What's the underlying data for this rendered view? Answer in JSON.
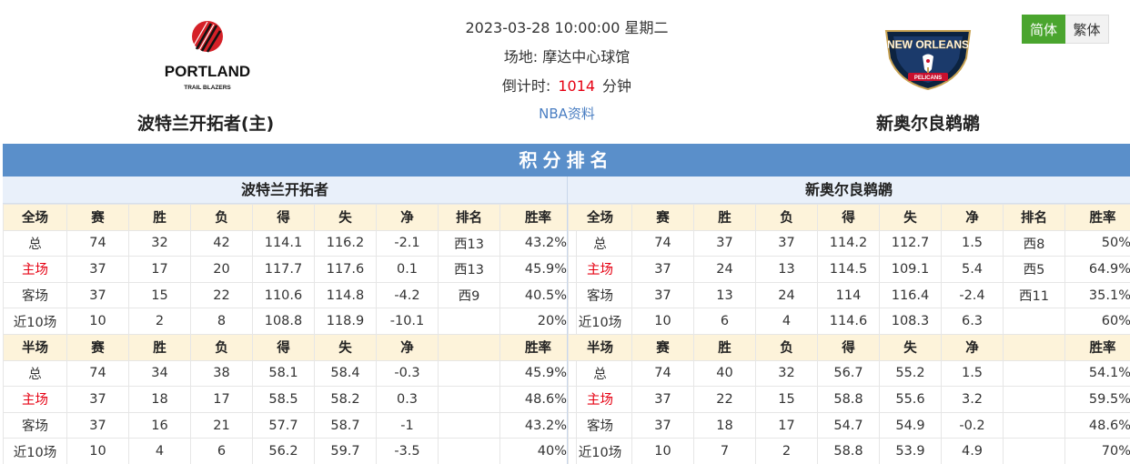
{
  "header": {
    "datetime": "2023-03-28 10:00:00 星期二",
    "venue": "场地: 摩达中心球馆",
    "countdown_label": "倒计时:",
    "countdown_value": "1014",
    "countdown_unit": "分钟",
    "nba_link": "NBA资料",
    "lang": {
      "simplified": "简体",
      "traditional": "繁体"
    },
    "home_team": {
      "name": "波特兰开拓者(主)",
      "logo_text": "PORTLAND",
      "logo_sub": "TRAIL BLAZERS",
      "logo_icon": "trail-blazers-pinwheel"
    },
    "away_team": {
      "name": "新奥尔良鹈鹕",
      "logo_text": "NEW ORLEANS",
      "logo_sub": "PELICANS",
      "logo_icon": "pelicans-shield"
    }
  },
  "colors": {
    "title_bar": "#5a8fca",
    "header_row": "#fdf3da",
    "home_highlight": "#e60012",
    "active_lang": "#4aa52e"
  },
  "standings": {
    "title": "积分排名",
    "home": {
      "team": "波特兰开拓者",
      "full": {
        "header": [
          "全场",
          "赛",
          "胜",
          "负",
          "得",
          "失",
          "净",
          "排名",
          "胜率"
        ],
        "rows": [
          [
            "总",
            "74",
            "32",
            "42",
            "114.1",
            "116.2",
            "-2.1",
            "西13",
            "43.2%"
          ],
          [
            "主场",
            "37",
            "17",
            "20",
            "117.7",
            "117.6",
            "0.1",
            "西13",
            "45.9%"
          ],
          [
            "客场",
            "37",
            "15",
            "22",
            "110.6",
            "114.8",
            "-4.2",
            "西9",
            "40.5%"
          ],
          [
            "近10场",
            "10",
            "2",
            "8",
            "108.8",
            "118.9",
            "-10.1",
            "",
            "20%"
          ]
        ]
      },
      "half": {
        "header": [
          "半场",
          "赛",
          "胜",
          "负",
          "得",
          "失",
          "净",
          "",
          "胜率"
        ],
        "rows": [
          [
            "总",
            "74",
            "34",
            "38",
            "58.1",
            "58.4",
            "-0.3",
            "",
            "45.9%"
          ],
          [
            "主场",
            "37",
            "18",
            "17",
            "58.5",
            "58.2",
            "0.3",
            "",
            "48.6%"
          ],
          [
            "客场",
            "37",
            "16",
            "21",
            "57.7",
            "58.7",
            "-1",
            "",
            "43.2%"
          ],
          [
            "近10场",
            "10",
            "4",
            "6",
            "56.2",
            "59.7",
            "-3.5",
            "",
            "40%"
          ]
        ]
      }
    },
    "away": {
      "team": "新奥尔良鹈鹕",
      "full": {
        "header": [
          "全场",
          "赛",
          "胜",
          "负",
          "得",
          "失",
          "净",
          "排名",
          "胜率"
        ],
        "rows": [
          [
            "总",
            "74",
            "37",
            "37",
            "114.2",
            "112.7",
            "1.5",
            "西8",
            "50%"
          ],
          [
            "主场",
            "37",
            "24",
            "13",
            "114.5",
            "109.1",
            "5.4",
            "西5",
            "64.9%"
          ],
          [
            "客场",
            "37",
            "13",
            "24",
            "114",
            "116.4",
            "-2.4",
            "西11",
            "35.1%"
          ],
          [
            "近10场",
            "10",
            "6",
            "4",
            "114.6",
            "108.3",
            "6.3",
            "",
            "60%"
          ]
        ]
      },
      "half": {
        "header": [
          "半场",
          "赛",
          "胜",
          "负",
          "得",
          "失",
          "净",
          "",
          "胜率"
        ],
        "rows": [
          [
            "总",
            "74",
            "40",
            "32",
            "56.7",
            "55.2",
            "1.5",
            "",
            "54.1%"
          ],
          [
            "主场",
            "37",
            "22",
            "15",
            "58.8",
            "55.6",
            "3.2",
            "",
            "59.5%"
          ],
          [
            "客场",
            "37",
            "18",
            "17",
            "54.7",
            "54.9",
            "-0.2",
            "",
            "48.6%"
          ],
          [
            "近10场",
            "10",
            "7",
            "2",
            "58.8",
            "53.9",
            "4.9",
            "",
            "70%"
          ]
        ]
      }
    }
  }
}
